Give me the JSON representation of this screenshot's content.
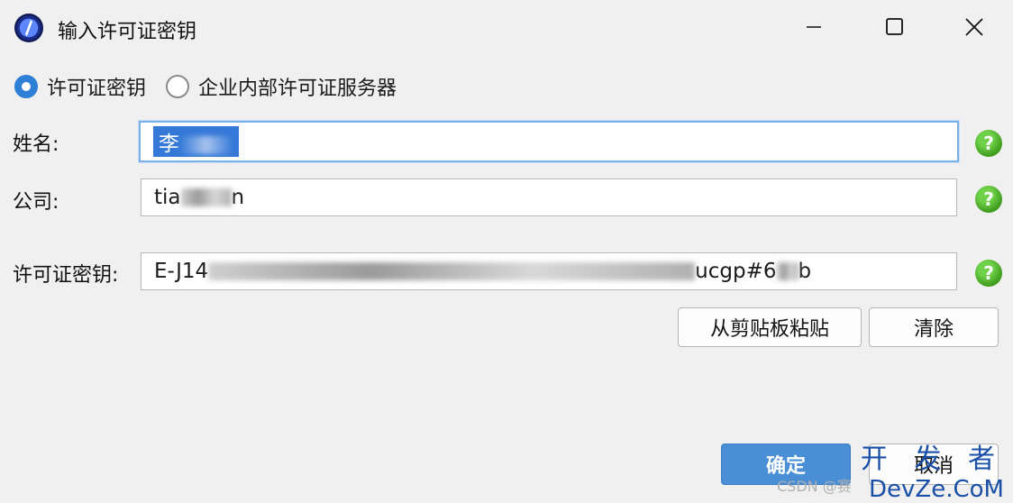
{
  "window": {
    "title": "输入许可证密钥",
    "icon": "compass-icon",
    "controls": {
      "minimize": "minimize-icon",
      "maximize": "maximize-icon",
      "close": "close-icon"
    }
  },
  "license_mode": {
    "options": [
      {
        "label": "许可证密钥",
        "selected": true
      },
      {
        "label": "企业内部许可证服务器",
        "selected": false
      }
    ]
  },
  "form": {
    "name_label": "姓名:",
    "name_value_visible": "李",
    "company_label": "公司:",
    "company_value_prefix": "tia",
    "company_value_suffix": "n",
    "key_label": "许可证密钥:",
    "key_value_prefix": "E-J14",
    "key_value_suffix": "ucgp#6",
    "key_value_end": "b",
    "help_symbol": "?"
  },
  "buttons": {
    "paste": "从剪贴板粘贴",
    "clear": "清除",
    "ok": "确定",
    "cancel": "取消"
  },
  "colors": {
    "accent": "#4a8fd6",
    "help_green": "#3e9c1d",
    "selection": "#3478d8"
  },
  "watermark": {
    "line1": "开 发 者",
    "line2": "DevZe.CoM",
    "csdn": "CSDN @赛"
  }
}
